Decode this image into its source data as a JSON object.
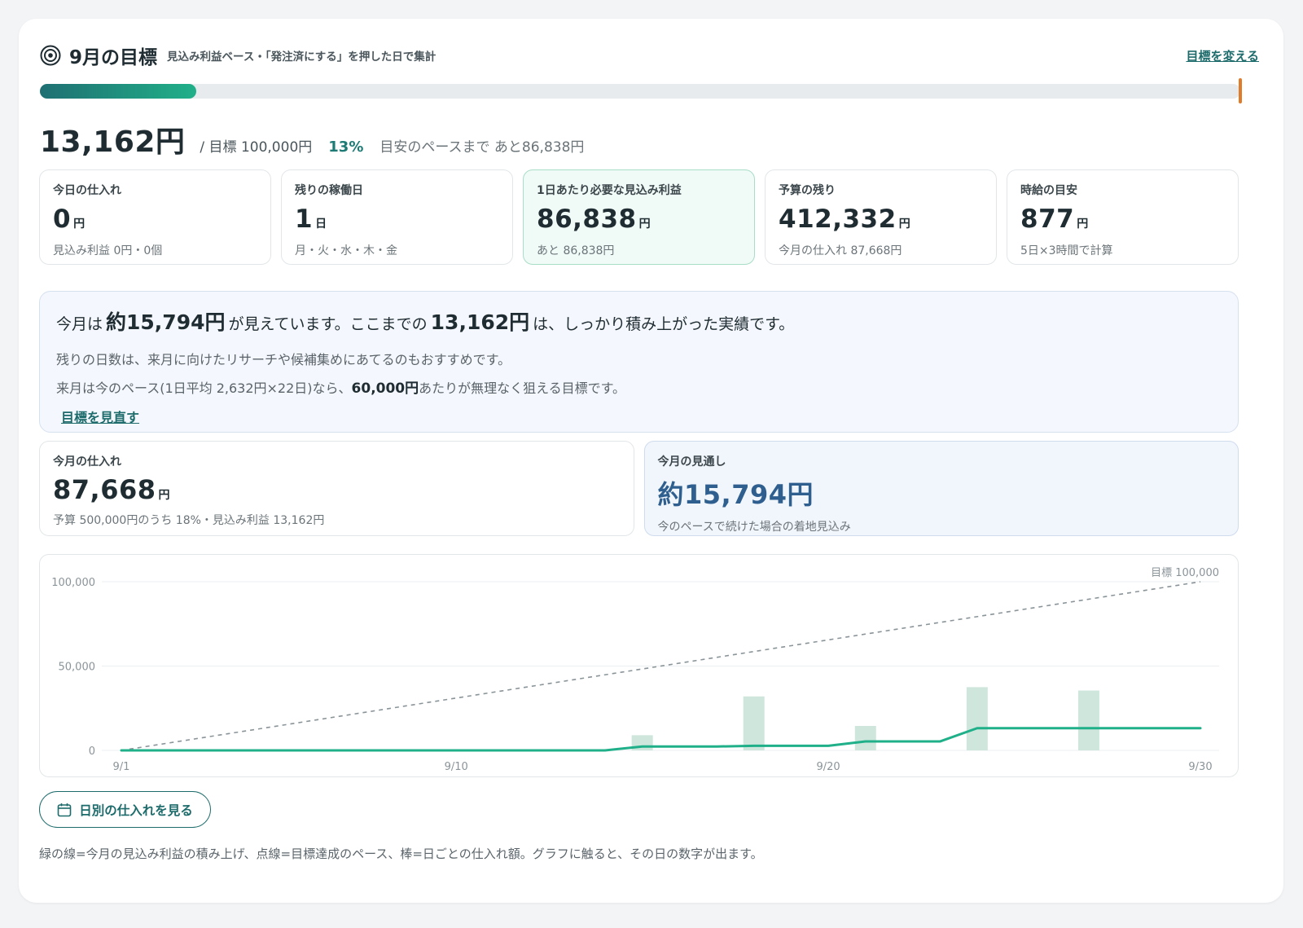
{
  "header": {
    "title": "9月の目標",
    "subtitle": "見込み利益ベース・「発注済にする」を押した日で集計",
    "change_link": "目標を変える",
    "icon": "target-icon"
  },
  "progress": {
    "fraction": 0.13,
    "marker_color": "#e07b2a"
  },
  "summary": {
    "total": "13,162円",
    "goal_text": "/ 目標 100,000円",
    "percent": "13%",
    "pace_text": "目安のペースまで あと86,838円"
  },
  "stats": [
    {
      "label": "今日の仕入れ",
      "value": "0",
      "unit": "円",
      "sub": "見込み利益 0円・0個"
    },
    {
      "label": "残りの稼働日",
      "value": "1",
      "unit": "日",
      "sub": "月・火・水・木・金"
    },
    {
      "label": "1日あたり必要な見込み利益",
      "value": "86,838",
      "unit": "円",
      "sub": "あと 86,838円"
    },
    {
      "label": "予算の残り",
      "value": "412,332",
      "unit": "円",
      "sub": "今月の仕入れ 87,668円"
    },
    {
      "label": "時給の目安",
      "value": "877",
      "unit": "円",
      "sub": "5日×3時間で計算"
    }
  ],
  "message": {
    "line1_a": "今月は",
    "line1_b": "約15,794円",
    "line1_c": "が見えています。ここまでの",
    "line1_d": "13,162円",
    "line1_e": "は、しっかり積み上がった実績です。",
    "line2": "残りの日数は、来月に向けたリサーチや候補集めにあてるのもおすすめです。",
    "line3_a": "来月は今のペース(1日平均 2,632円×22日)なら、",
    "line3_b": "60,000円",
    "line3_c": "あたりが無理なく狙える目標です。",
    "link": "目標を見直す"
  },
  "purchase": {
    "label": "今月の仕入れ",
    "value": "87,668",
    "unit": "円",
    "sub": "予算 500,000円のうち 18%・見込み利益 13,162円"
  },
  "forecast": {
    "label": "今月の見通し",
    "value": "約15,794円",
    "sub": "今のペースで続けた場合の着地見込み"
  },
  "chart_data": {
    "type": "line",
    "y_ticks": [
      "100,000",
      "50,000",
      "0"
    ],
    "x_ticks": [
      "9/1",
      "9/10",
      "9/20",
      "9/30"
    ],
    "goal_label": "目標 100,000",
    "ylim": [
      0,
      100000
    ],
    "xlim": [
      1,
      30
    ],
    "grid": true,
    "series": [
      {
        "type": "line",
        "style": "solid",
        "color": "#20b089",
        "x": [
          1,
          2,
          3,
          4,
          5,
          6,
          7,
          8,
          9,
          10,
          11,
          12,
          13,
          14,
          15,
          16,
          17,
          18,
          19,
          20,
          21,
          22,
          23,
          24,
          25,
          26,
          27,
          28,
          29,
          30
        ],
        "y": [
          0,
          0,
          0,
          0,
          0,
          0,
          0,
          0,
          0,
          0,
          0,
          0,
          0,
          0,
          2300,
          2300,
          2300,
          2700,
          2700,
          2700,
          5300,
          5300,
          5300,
          13162,
          13162,
          13162,
          13162,
          13162,
          13162,
          13162
        ]
      },
      {
        "type": "line",
        "style": "dashed",
        "color": "#8a9499",
        "x": [
          1,
          30
        ],
        "y": [
          0,
          100000
        ]
      },
      {
        "type": "bar",
        "color": "#cfe6dc",
        "x": [
          15,
          18,
          21,
          24,
          27
        ],
        "y": [
          9000,
          32000,
          14500,
          37500,
          35500
        ]
      }
    ]
  },
  "daily_button": {
    "label": "日別の仕入れを見る",
    "icon": "calendar-icon"
  },
  "footnote": "緑の線=今月の見込み利益の積み上げ、点線=目標達成のペース、棒=日ごとの仕入れ額。グラフに触ると、その日の数字が出ます。"
}
